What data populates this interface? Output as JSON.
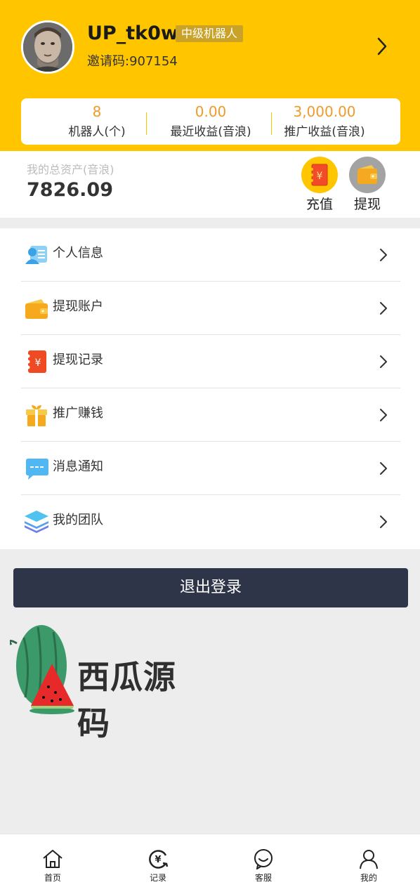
{
  "header": {
    "username": "UP_tk0w",
    "level_badge": "中级机器人",
    "invite_code": "邀请码:907154"
  },
  "stats": [
    {
      "value": "8",
      "label": "机器人(个)"
    },
    {
      "value": "0.00",
      "label": "最近收益(音浪)"
    },
    {
      "value": "3,000.00",
      "label": "推广收益(音浪)"
    }
  ],
  "assets": {
    "label": "我的总资产(音浪)",
    "value": "7826.09",
    "recharge_label": "充值",
    "withdraw_label": "提现"
  },
  "menu": [
    {
      "label": "个人信息",
      "icon": "id-card-icon"
    },
    {
      "label": "提现账户",
      "icon": "wallet-icon"
    },
    {
      "label": "提现记录",
      "icon": "receipt-icon"
    },
    {
      "label": "推广赚钱",
      "icon": "gift-icon"
    },
    {
      "label": "消息通知",
      "icon": "message-icon"
    },
    {
      "label": "我的团队",
      "icon": "layers-icon"
    }
  ],
  "logout_label": "退出登录",
  "watermark_text": "西瓜源码",
  "tabbar": [
    {
      "label": "首页",
      "icon": "home-icon"
    },
    {
      "label": "记录",
      "icon": "record-icon"
    },
    {
      "label": "客服",
      "icon": "service-icon"
    },
    {
      "label": "我的",
      "icon": "profile-icon"
    }
  ],
  "colors": {
    "header_bg": "#ffc600",
    "accent_orange": "#f19a2c",
    "logout_bg": "#2e3548",
    "page_bg": "#ededed"
  }
}
